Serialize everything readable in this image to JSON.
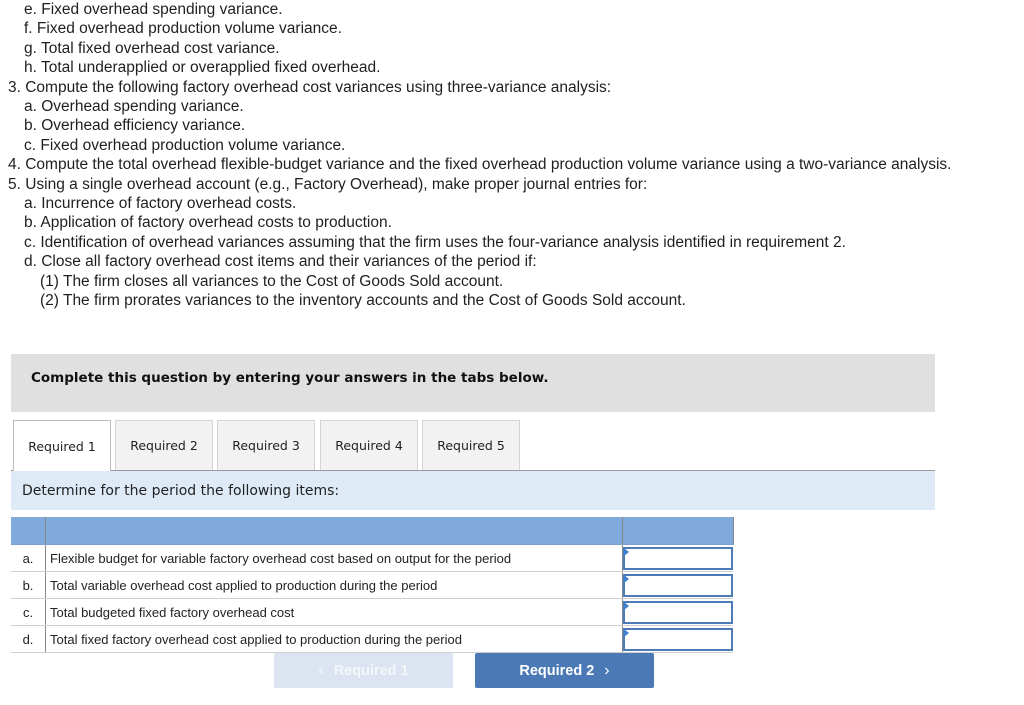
{
  "question": {
    "lines": [
      {
        "level": 1,
        "text": "e. Fixed overhead spending variance."
      },
      {
        "level": 1,
        "text": "f. Fixed overhead production volume variance."
      },
      {
        "level": 1,
        "text": "g. Total fixed overhead cost variance."
      },
      {
        "level": 1,
        "text": "h. Total underapplied or overapplied fixed overhead."
      },
      {
        "level": 0,
        "text": "3. Compute the following factory overhead cost variances using three-variance analysis:"
      },
      {
        "level": 1,
        "text": "a. Overhead spending variance."
      },
      {
        "level": 1,
        "text": "b. Overhead efficiency variance."
      },
      {
        "level": 1,
        "text": "c. Fixed overhead production volume variance."
      },
      {
        "level": 0,
        "text": "4. Compute the total overhead flexible-budget variance and the fixed overhead production volume variance using a two-variance analysis."
      },
      {
        "level": 0,
        "text": "5. Using a single overhead account (e.g., Factory Overhead), make proper journal entries for:"
      },
      {
        "level": 1,
        "text": "a. Incurrence of factory overhead costs."
      },
      {
        "level": 1,
        "text": "b. Application of factory overhead costs to production."
      },
      {
        "level": 1,
        "text": "c. Identification of overhead variances assuming that the firm uses the four-variance analysis identified in requirement 2."
      },
      {
        "level": 1,
        "text": "d. Close all factory overhead cost items and their variances of the period if:"
      },
      {
        "level": 2,
        "text": "(1) The firm closes all variances to the Cost of Goods Sold account."
      },
      {
        "level": 2,
        "text": "(2) The firm prorates variances to the inventory accounts and the Cost of Goods Sold account."
      }
    ]
  },
  "instructions": "Complete this question by entering your answers in the tabs below.",
  "tabs": [
    {
      "label": "Required 1",
      "active": true
    },
    {
      "label": "Required 2",
      "active": false
    },
    {
      "label": "Required 3",
      "active": false
    },
    {
      "label": "Required 4",
      "active": false
    },
    {
      "label": "Required 5",
      "active": false
    }
  ],
  "panel": {
    "prompt": "Determine for the period the following items:"
  },
  "table": {
    "rows": [
      {
        "letter": "a.",
        "description": "Flexible budget for variable factory overhead cost based on output for the period",
        "value": ""
      },
      {
        "letter": "b.",
        "description": "Total variable overhead cost applied to production during the period",
        "value": ""
      },
      {
        "letter": "c.",
        "description": "Total budgeted fixed factory overhead cost",
        "value": ""
      },
      {
        "letter": "d.",
        "description": "Total fixed factory overhead cost applied to production during the period",
        "value": ""
      }
    ]
  },
  "navigation": {
    "prev_label": "Required 1",
    "prev_icon": "‹",
    "next_label": "Required 2",
    "next_icon": "›"
  },
  "colors": {
    "header_blue": "#80a9dc",
    "panel_blue": "#deebf7",
    "button_blue": "#4a79b6",
    "button_disabled": "#dbe4f0"
  }
}
